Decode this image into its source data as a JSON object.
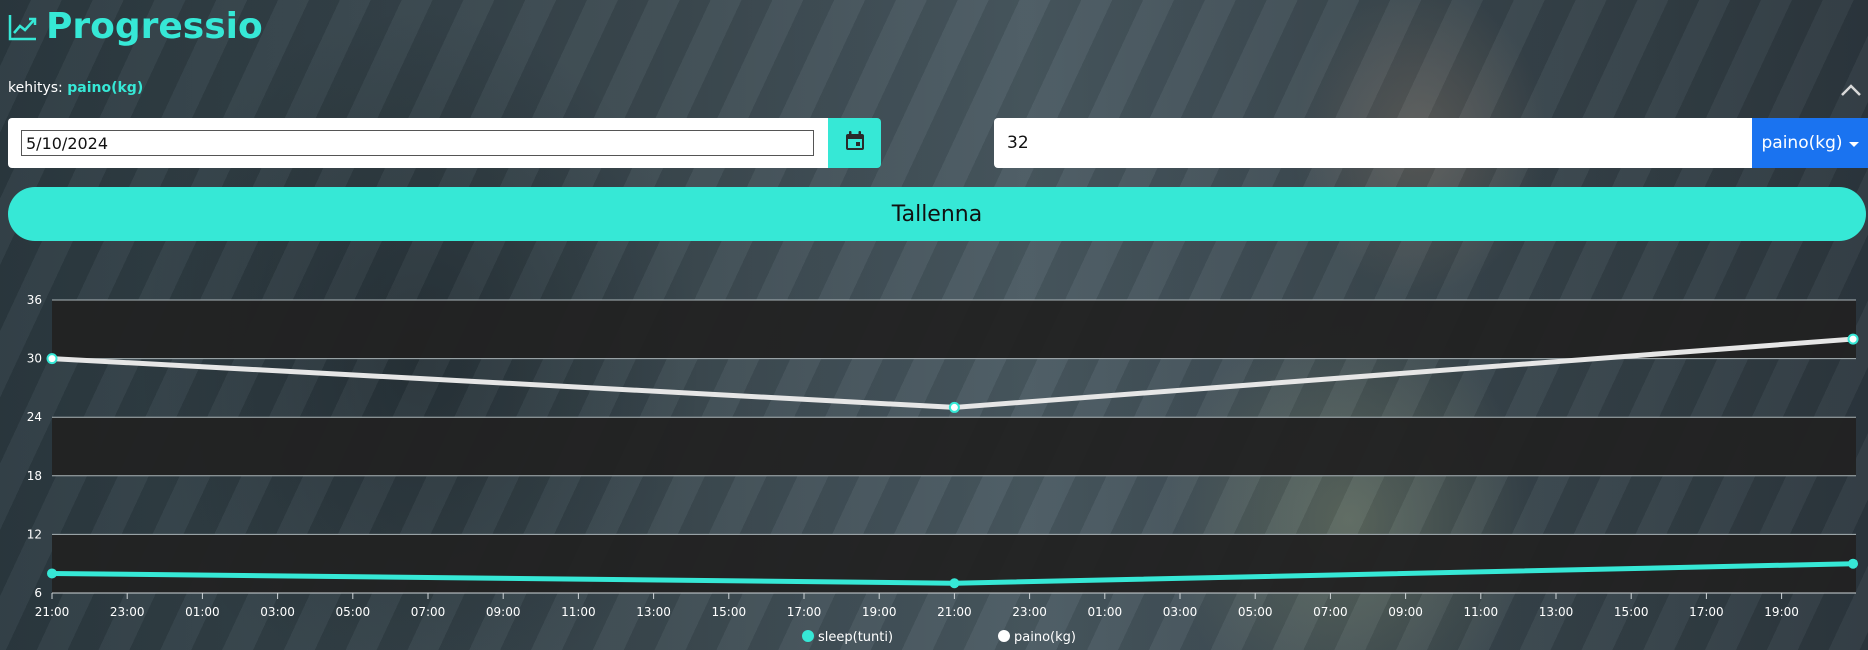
{
  "header": {
    "title": "Progressio",
    "subtitle_label": "kehitys:",
    "subtitle_metric": "paino(kg)"
  },
  "form": {
    "date_value": "5/10/2024",
    "amount_value": "32",
    "metric_dropdown_label": "paino(kg)",
    "save_label": "Tallenna"
  },
  "colors": {
    "accent": "#36e8d6",
    "dropdown": "#1a73f0",
    "chart_band": "#222222",
    "line_weight": "#e6e6e6"
  },
  "chart_data": {
    "type": "line",
    "x": [
      "21:00",
      "21:00",
      "19:00"
    ],
    "x_tick_labels": [
      "21:00",
      "23:00",
      "01:00",
      "03:00",
      "05:00",
      "07:00",
      "09:00",
      "11:00",
      "13:00",
      "15:00",
      "17:00",
      "19:00",
      "21:00",
      "23:00",
      "01:00",
      "03:00",
      "05:00",
      "07:00",
      "09:00",
      "11:00",
      "13:00",
      "15:00",
      "17:00",
      "19:00"
    ],
    "y_ticks": [
      6,
      12,
      18,
      24,
      30,
      36
    ],
    "ylim": [
      6,
      36
    ],
    "series": [
      {
        "name": "sleep(tunti)",
        "color": "#36e8d6",
        "values": [
          8,
          7,
          9
        ]
      },
      {
        "name": "paino(kg)",
        "color": "#e6e6e6",
        "values": [
          30,
          25,
          32
        ]
      }
    ],
    "legend_position": "bottom",
    "grid": true
  }
}
